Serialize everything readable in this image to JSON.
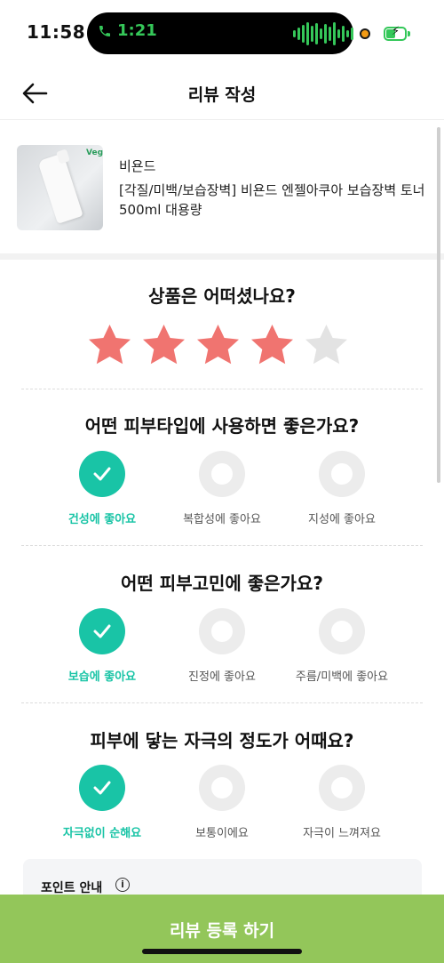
{
  "status_bar": {
    "time": "11:58",
    "call_time": "1:21"
  },
  "header": {
    "title": "리뷰 작성"
  },
  "product": {
    "brand": "비욘드",
    "name": "[각질/미백/보습장벽] 비욘드 엔젤아쿠아 보습장벽 토너 500ml 대용량",
    "badge": "Vegan"
  },
  "rating": {
    "question": "상품은 어떠셨나요?",
    "value": 4,
    "max": 5,
    "filled_color": "#f07470",
    "empty_color": "#e3e3e3"
  },
  "skin_type": {
    "question": "어떤 피부타입에 사용하면 좋은가요?",
    "options": [
      "건성에 좋아요",
      "복합성에 좋아요",
      "지성에 좋아요"
    ],
    "selected": 0
  },
  "skin_concern": {
    "question": "어떤 피부고민에 좋은가요?",
    "options": [
      "보습에 좋아요",
      "진정에 좋아요",
      "주름/미백에 좋아요"
    ],
    "selected": 0
  },
  "irritation": {
    "question": "피부에 닿는 자극의 정도가 어때요?",
    "options": [
      "자극없이 순해요",
      "보통이에요",
      "자극이 느껴져요"
    ],
    "selected": 0
  },
  "points": {
    "title": "포인트 안내",
    "info_icon": "i"
  },
  "submit": {
    "label": "리뷰 등록 하기"
  },
  "colors": {
    "accent": "#19c4a6",
    "submit_bg": "#93c65a"
  }
}
